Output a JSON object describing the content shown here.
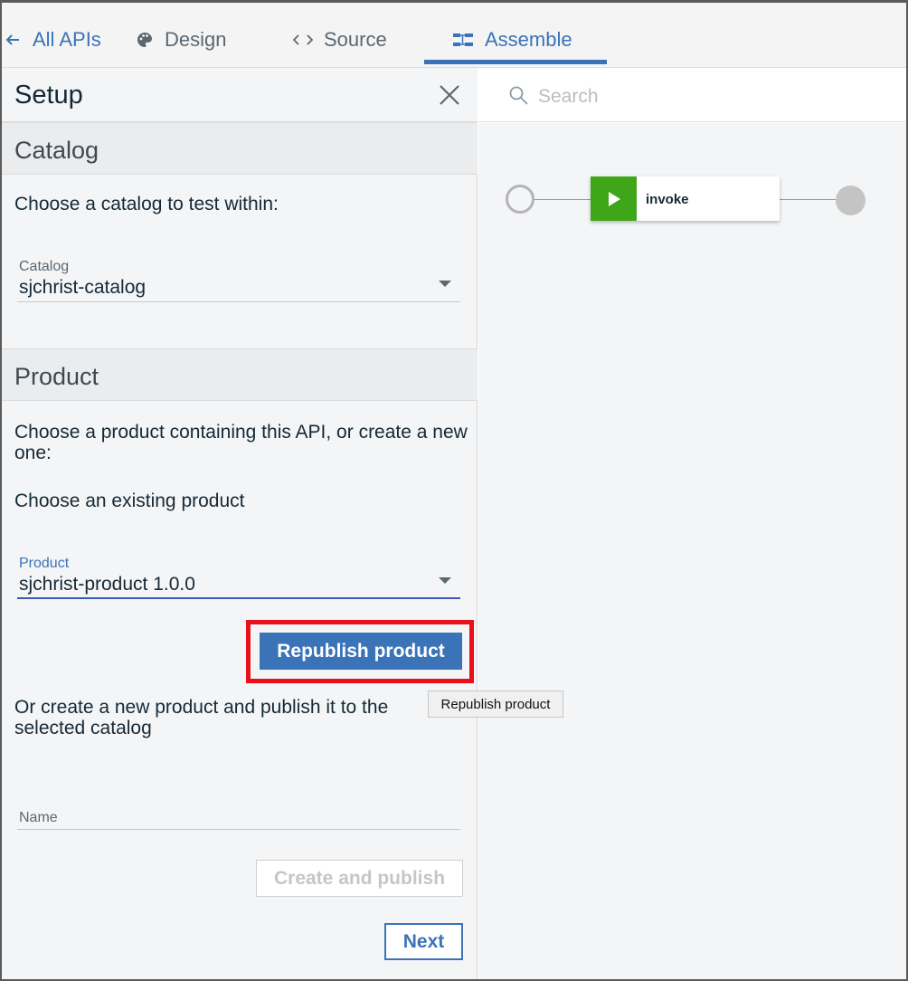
{
  "nav": {
    "back_label": "All APIs",
    "tabs": [
      {
        "label": "Design",
        "icon": "palette-icon"
      },
      {
        "label": "Source",
        "icon": "code-icon"
      },
      {
        "label": "Assemble",
        "icon": "assemble-icon",
        "active": true
      }
    ]
  },
  "setup": {
    "title": "Setup",
    "catalog_section": {
      "heading": "Catalog",
      "instruction": "Choose a catalog to test within:",
      "field_label": "Catalog",
      "selected_value": "sjchrist-catalog"
    },
    "product_section": {
      "heading": "Product",
      "instruction": "Choose a product containing this API, or create a new one:",
      "existing_label": "Choose an existing product",
      "field_label": "Product",
      "selected_value": "sjchrist-product 1.0.0",
      "republish_button": "Republish product",
      "republish_tooltip": "Republish product",
      "create_text": "Or create a new product and publish it to the selected catalog",
      "name_placeholder": "Name",
      "create_button": "Create and publish"
    },
    "next_button": "Next"
  },
  "canvas": {
    "search_placeholder": "Search",
    "policy_label": "invoke"
  },
  "colors": {
    "accent": "#3b73b9",
    "highlight": "#e8101a",
    "invoke": "#3fa619"
  }
}
